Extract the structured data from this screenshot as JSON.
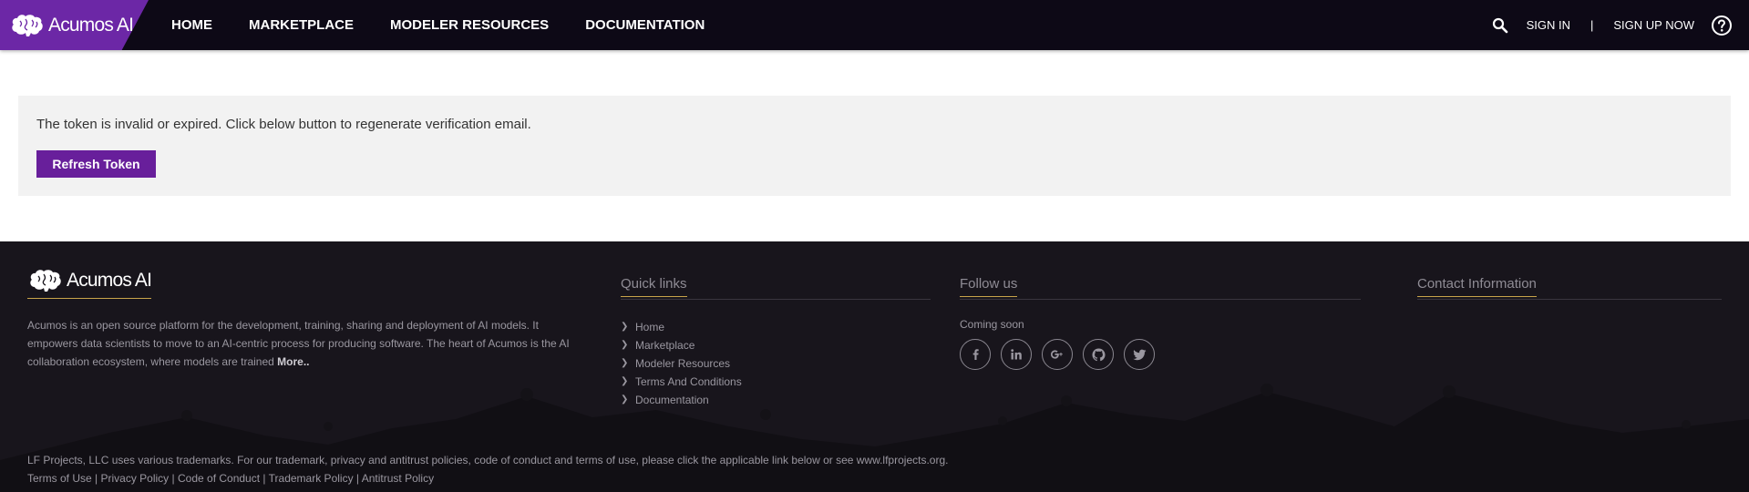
{
  "header": {
    "logo_text": "Acumos AI",
    "nav": [
      "HOME",
      "MARKETPLACE",
      "MODELER RESOURCES",
      "DOCUMENTATION"
    ],
    "sign_in": "SIGN IN",
    "separator": "|",
    "sign_up": "SIGN UP NOW"
  },
  "message": {
    "text": "The token is invalid or expired. Click below button to regenerate verification email.",
    "button": "Refresh Token"
  },
  "footer": {
    "logo_text": "Acumos AI",
    "about": "Acumos is an open source platform for the development, training, sharing and deployment of AI models. It empowers data scientists to move to an AI-centric process for producing software. The heart of Acumos is the AI collaboration ecosystem, where models are trained",
    "more": "More..",
    "quick_links_title": "Quick links",
    "quick_links": [
      "Home",
      "Marketplace",
      "Modeler Resources",
      "Terms And Conditions",
      "Documentation"
    ],
    "follow_title": "Follow us",
    "coming_soon": "Coming soon",
    "socials": [
      {
        "name": "facebook-icon",
        "glyph": "f"
      },
      {
        "name": "linkedin-icon",
        "glyph": "in"
      },
      {
        "name": "google-plus-icon",
        "glyph": "G+"
      },
      {
        "name": "github-icon",
        "glyph": "gh"
      },
      {
        "name": "twitter-icon",
        "glyph": "tw"
      }
    ],
    "contact_title": "Contact Information",
    "legal_text": "LF Projects, LLC uses various trademarks. For our trademark, privacy and antitrust policies, code of conduct and terms of use, please click the applicable link below or see www.lfprojects.org.",
    "legal_links": [
      "Terms of Use",
      "Privacy Policy",
      "Code of Conduct",
      "Trademark Policy",
      "Antitrust Policy"
    ],
    "legal_sep": "|"
  }
}
